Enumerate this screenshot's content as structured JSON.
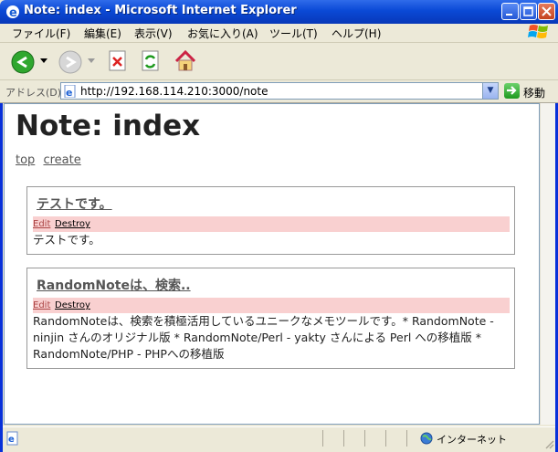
{
  "window": {
    "title": "Note: index - Microsoft Internet Explorer"
  },
  "menu": [
    "ファイル(F)",
    "編集(E)",
    "表示(V)",
    "お気に入り(A)",
    "ツール(T)",
    "ヘルプ(H)"
  ],
  "address": {
    "label": "アドレス(D)",
    "url": "http://192.168.114.210:3000/note",
    "go_label": "移動"
  },
  "page": {
    "title": "Note: index",
    "nav": [
      {
        "label": "top"
      },
      {
        "label": "create"
      }
    ],
    "notes": [
      {
        "title": "テストです。",
        "edit": "Edit",
        "destroy": "Destroy",
        "body": "テストです。"
      },
      {
        "title": "RandomNoteは、検索..",
        "edit": "Edit",
        "destroy": "Destroy",
        "body": "RandomNoteは、検索を積極活用しているユニークなメモツールです。* RandomNote - ninjin さんのオリジナル版 * RandomNote/Perl - yakty さんによる Perl への移植版 * RandomNote/PHP - PHPへの移植版"
      }
    ]
  },
  "status": {
    "zone": "インターネット"
  },
  "colors": {
    "titlebar": "#0a49d6",
    "action_bg": "#f9d0d0"
  }
}
